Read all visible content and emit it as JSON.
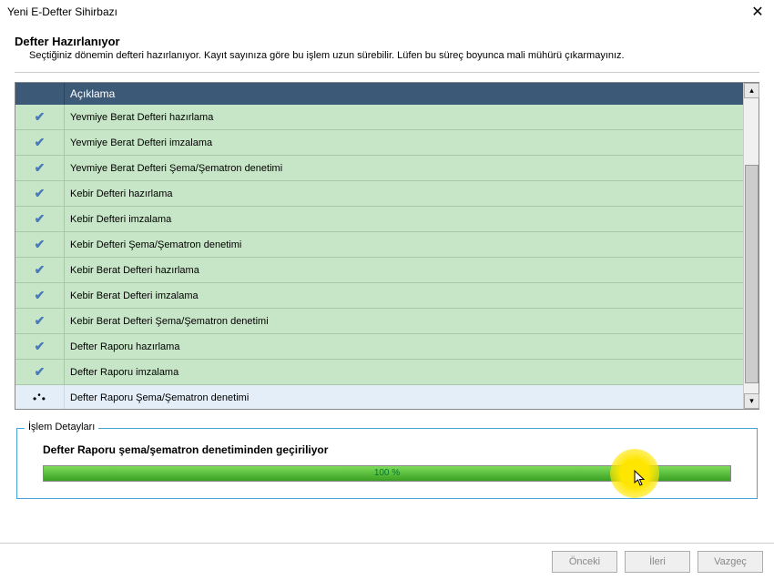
{
  "window": {
    "title": "Yeni E-Defter Sihirbazı"
  },
  "header": {
    "title": "Defter Hazırlanıyor",
    "description": "Seçtiğiniz dönemin defteri hazırlanıyor. Kayıt sayınıza göre bu işlem uzun sürebilir. Lüfen bu süreç boyunca mali mühürü çıkarmayınız."
  },
  "grid": {
    "header_desc": "Açıklama",
    "rows": [
      {
        "status": "done",
        "text": "Yevmiye Berat Defteri hazırlama"
      },
      {
        "status": "done",
        "text": "Yevmiye Berat Defteri imzalama"
      },
      {
        "status": "done",
        "text": "Yevmiye Berat Defteri Şema/Şematron denetimi"
      },
      {
        "status": "done",
        "text": "Kebir Defteri hazırlama"
      },
      {
        "status": "done",
        "text": "Kebir Defteri imzalama"
      },
      {
        "status": "done",
        "text": "Kebir Defteri Şema/Şematron denetimi"
      },
      {
        "status": "done",
        "text": "Kebir Berat Defteri hazırlama"
      },
      {
        "status": "done",
        "text": "Kebir Berat Defteri imzalama"
      },
      {
        "status": "done",
        "text": "Kebir Berat Defteri Şema/Şematron denetimi"
      },
      {
        "status": "done",
        "text": "Defter Raporu hazırlama"
      },
      {
        "status": "done",
        "text": "Defter Raporu imzalama"
      },
      {
        "status": "active",
        "text": "Defter Raporu Şema/Şematron denetimi"
      }
    ]
  },
  "details": {
    "legend": "İşlem Detayları",
    "text": "Defter Raporu şema/şematron denetiminden geçiriliyor",
    "progress_label": "100 %",
    "progress_pct": 100
  },
  "footer": {
    "prev": "Önceki",
    "next": "İleri",
    "cancel": "Vazgeç"
  }
}
